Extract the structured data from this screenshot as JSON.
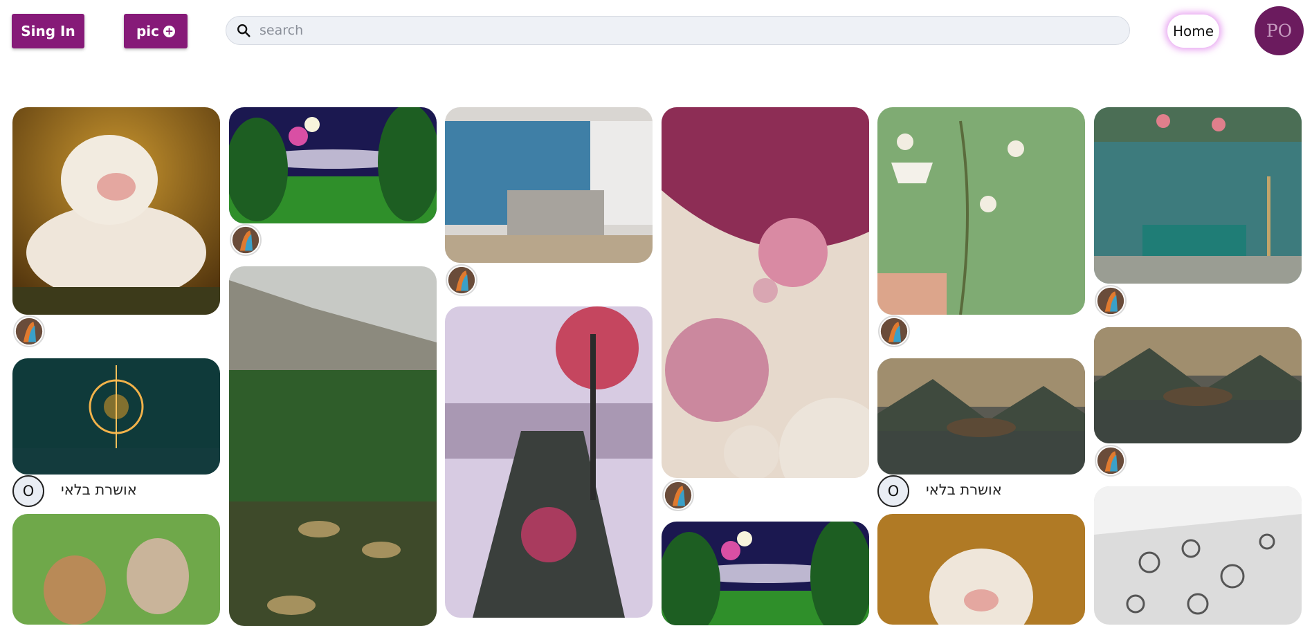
{
  "header": {
    "sign_in_label": "Sing In",
    "pic_label": "pic",
    "pic_icon": "plus-circle-icon",
    "search_placeholder": "search",
    "home_label": "Home",
    "avatar_initials": "PO"
  },
  "accent_color": "#861a78",
  "gallery": {
    "user_name": "אושרת בלאי",
    "user_initial": "O"
  }
}
